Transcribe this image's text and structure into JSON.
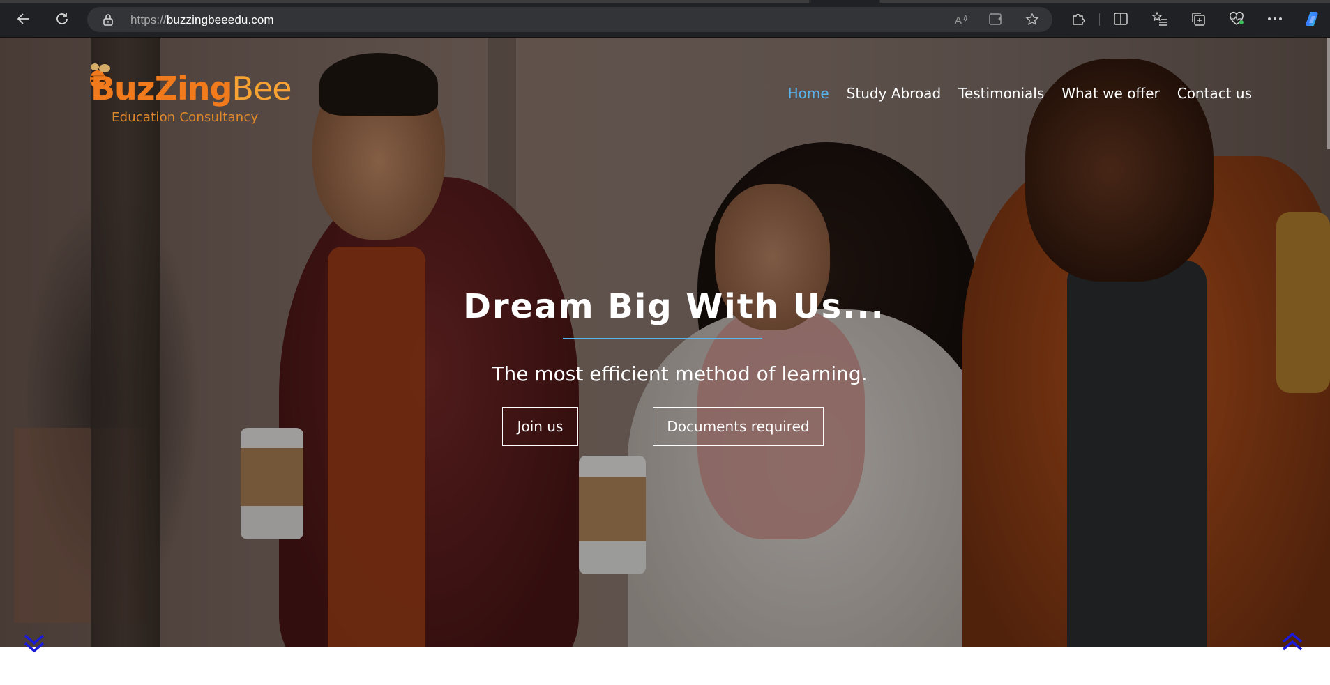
{
  "browser": {
    "url_protocol": "https://",
    "url_host": "buzzingbeeedu.com",
    "icons": {
      "back": "back-arrow-icon",
      "reload": "reload-icon",
      "lock": "lock-icon",
      "read_aloud": "read-aloud-icon",
      "immersive_reader": "immersive-reader-icon",
      "favorite": "star-icon",
      "extensions": "puzzle-icon",
      "split_screen": "split-screen-icon",
      "favorites": "favorites-list-icon",
      "collections": "collections-icon",
      "browser_essentials": "heart-pulse-icon",
      "more": "more-icon",
      "copilot": "copilot-icon"
    }
  },
  "site": {
    "logo": {
      "word_part1": "BuzZing",
      "word_part2": "Bee",
      "subtitle": "Education Consultancy"
    },
    "nav": [
      {
        "label": "Home",
        "active": true
      },
      {
        "label": "Study Abroad",
        "active": false
      },
      {
        "label": "Testimonials",
        "active": false
      },
      {
        "label": "What we offer",
        "active": false
      },
      {
        "label": "Contact us",
        "active": false
      }
    ],
    "hero": {
      "headline": "Dream Big With Us...",
      "tagline": "The most efficient method of learning.",
      "buttons": {
        "join": "Join us",
        "documents": "Documents required"
      }
    },
    "scroll": {
      "down_icon": "double-chevron-down-icon",
      "up_icon": "double-chevron-up-icon"
    }
  },
  "colors": {
    "accent_blue": "#5ab4ee",
    "logo_orange": "#f07a1c",
    "logo_light_orange": "#f7a233",
    "scroll_arrow_blue": "#1a1adb"
  }
}
